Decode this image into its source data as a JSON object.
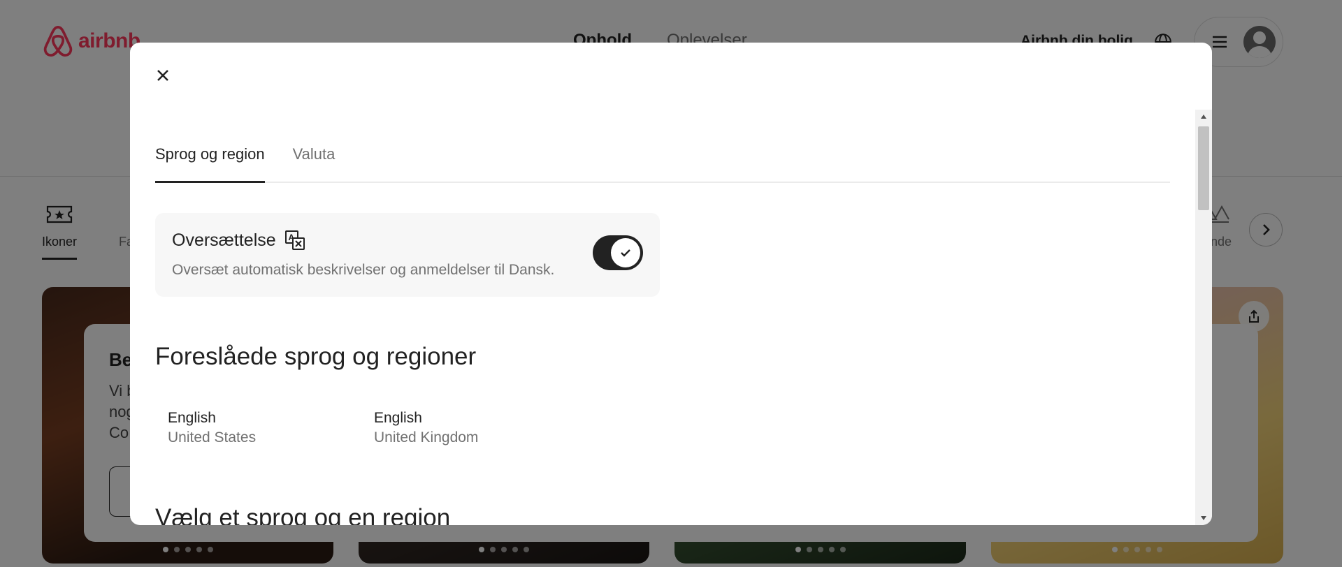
{
  "background": {
    "logo_text": "airbnb",
    "nav_tabs": [
      "Ophold",
      "Oplevelser"
    ],
    "host_link": "Airbnb din bolig",
    "categories": [
      "Ikoner",
      "Fa"
    ],
    "category_right": "lande",
    "promo": {
      "title": "Be",
      "lines": [
        "Vi b",
        "nog",
        "Co"
      ]
    }
  },
  "modal": {
    "tabs": [
      {
        "label": "Sprog og region",
        "active": true
      },
      {
        "label": "Valuta",
        "active": false
      }
    ],
    "translation": {
      "title": "Oversættelse",
      "description": "Oversæt automatisk beskrivelser og anmeldelser til Dansk.",
      "enabled": true
    },
    "suggested_heading": "Foreslåede sprog og regioner",
    "suggested": [
      {
        "language": "English",
        "region": "United States"
      },
      {
        "language": "English",
        "region": "United Kingdom"
      }
    ],
    "choose_heading": "Vælg et sprog og en region"
  },
  "colors": {
    "brand": "#ff385c",
    "text": "#222222",
    "muted": "#717171",
    "panel": "#f7f7f7"
  }
}
